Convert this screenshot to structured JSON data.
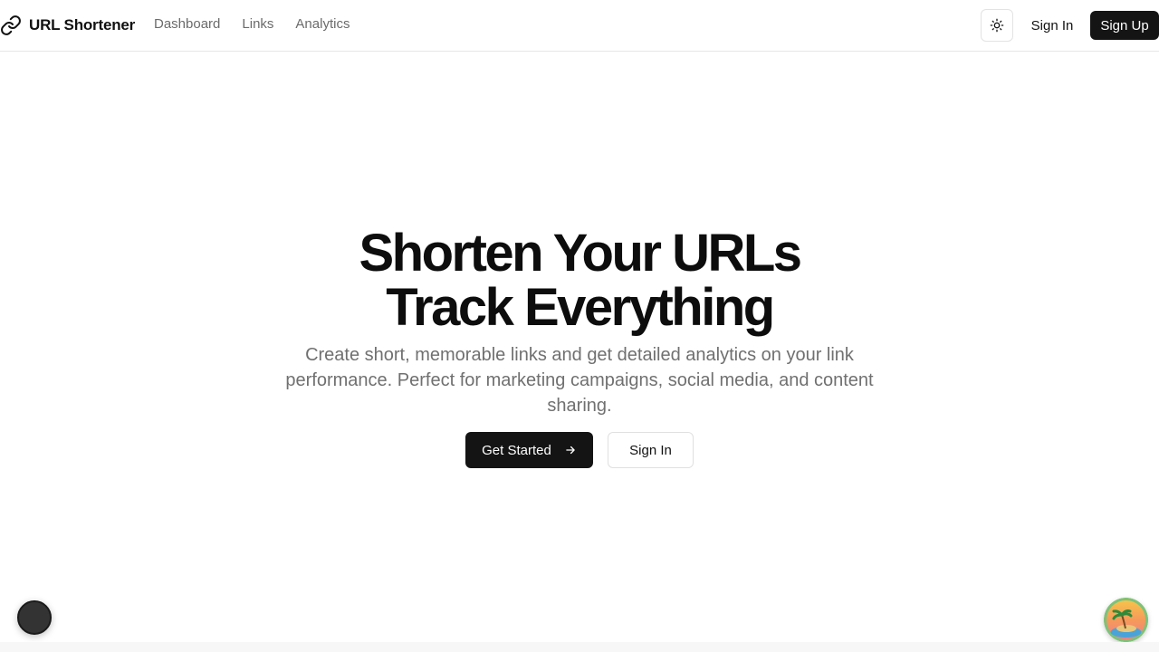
{
  "brand": {
    "name": "URL Shortener",
    "icon": "link-icon"
  },
  "nav": {
    "dashboard": "Dashboard",
    "links": "Links",
    "analytics": "Analytics"
  },
  "header_actions": {
    "theme_icon": "sun-icon",
    "sign_in": "Sign In",
    "sign_up": "Sign Up"
  },
  "hero": {
    "title_line1": "Shorten Your URLs",
    "title_line2": "Track Everything",
    "subtitle": "Create short, memorable links and get detailed analytics on your link performance. Perfect for marketing campaigns, social media, and content sharing.",
    "primary_cta": "Get Started",
    "primary_cta_icon": "arrow-right-icon",
    "secondary_cta": "Sign In"
  },
  "colors": {
    "primary": "#141414",
    "muted_text": "#707070",
    "nav_text": "#6b6b6b",
    "border": "#e6e6e6"
  }
}
